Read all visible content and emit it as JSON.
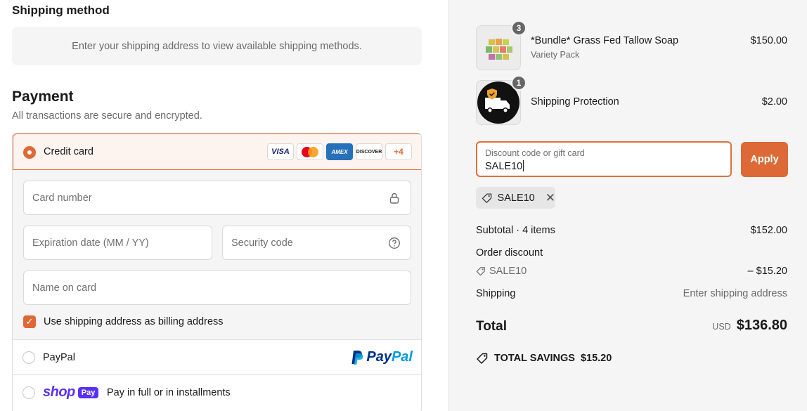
{
  "shipping": {
    "title": "Shipping method",
    "message": "Enter your shipping address to view available shipping methods."
  },
  "payment": {
    "title": "Payment",
    "subtitle": "All transactions are secure and encrypted.",
    "credit_card": {
      "label": "Credit card",
      "brands": [
        "VISA",
        "Mastercard",
        "AMEX",
        "DISCOVER"
      ],
      "more_label": "+4",
      "card_number_placeholder": "Card number",
      "expiration_placeholder": "Expiration date (MM / YY)",
      "security_code_placeholder": "Security code",
      "name_placeholder": "Name on card",
      "billing_checkbox_label": "Use shipping address as billing address",
      "billing_checkbox_checked": true
    },
    "paypal": {
      "label": "PayPal",
      "logo_text_1": "Pay",
      "logo_text_2": "Pal"
    },
    "shop_pay": {
      "logo_word": "shop",
      "logo_badge": "Pay",
      "label": "Pay in full or in installments"
    },
    "selected_method": "Credit card"
  },
  "order": {
    "items": [
      {
        "name": "*Bundle* Grass Fed Tallow Soap",
        "variant": "Variety Pack",
        "price": "$150.00",
        "quantity": "3",
        "thumb_icon": "soap-bundle-image"
      },
      {
        "name": "Shipping Protection",
        "variant": "",
        "price": "$2.00",
        "quantity": "1",
        "thumb_icon": "truck-shield-icon"
      }
    ],
    "discount_field": {
      "placeholder": "Discount code or gift card",
      "value": "SALE10",
      "apply_label": "Apply"
    },
    "applied_code": "SALE10",
    "summary": {
      "subtotal_label": "Subtotal · 4 items",
      "subtotal_value": "$152.00",
      "discount_label": "Order discount",
      "discount_code": "SALE10",
      "discount_value": "– $15.20",
      "shipping_label": "Shipping",
      "shipping_value": "Enter shipping address",
      "total_label": "Total",
      "currency": "USD",
      "total_value": "$136.80",
      "savings_label": "TOTAL SAVINGS",
      "savings_value": "$15.20"
    }
  },
  "colors": {
    "accent": "#dd6a36",
    "accent_border": "#e0703a",
    "shop_purple": "#5a31f4"
  }
}
